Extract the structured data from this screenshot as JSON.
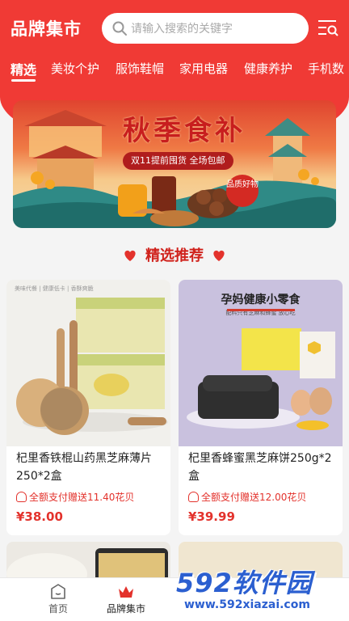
{
  "header": {
    "title": "品牌集市",
    "search_placeholder": "请输入搜索的关键字"
  },
  "tabs": [
    {
      "label": "精选",
      "active": true
    },
    {
      "label": "美妆个护"
    },
    {
      "label": "服饰鞋帽"
    },
    {
      "label": "家用电器"
    },
    {
      "label": "健康养护"
    },
    {
      "label": "手机数"
    }
  ],
  "banner": {
    "title": "秋季食补",
    "subtitle": "双11提前囤货 全场包邮",
    "badge": "品质好物"
  },
  "section": {
    "title": "精选推荐"
  },
  "products": [
    {
      "image_caption": "美味代餐 | 健康低卡 | 香酥爽脆",
      "name": "杞里香铁棍山药黑芝麻薄片250*2盒",
      "promo": "全额支付赠送11.40花贝",
      "price": "¥38.00"
    },
    {
      "image_caption": "孕妈健康小零食",
      "image_subcaption": "配料只有芝麻和蜂蜜 放心吃",
      "name": "杞里香蜂蜜黑芝麻饼250g*2盒",
      "promo": "全额支付赠送12.00花贝",
      "price": "¥39.99"
    }
  ],
  "bottom_nav": [
    {
      "label": "首页",
      "icon": "home-icon"
    },
    {
      "label": "品牌集市",
      "icon": "crown-icon",
      "active": true
    }
  ],
  "watermark": {
    "big": "592软件园",
    "small": "www.592xiazai.com"
  },
  "colors": {
    "brand_red": "#f03a35",
    "price_red": "#e3322c",
    "watermark_blue": "#2b5fd0"
  }
}
